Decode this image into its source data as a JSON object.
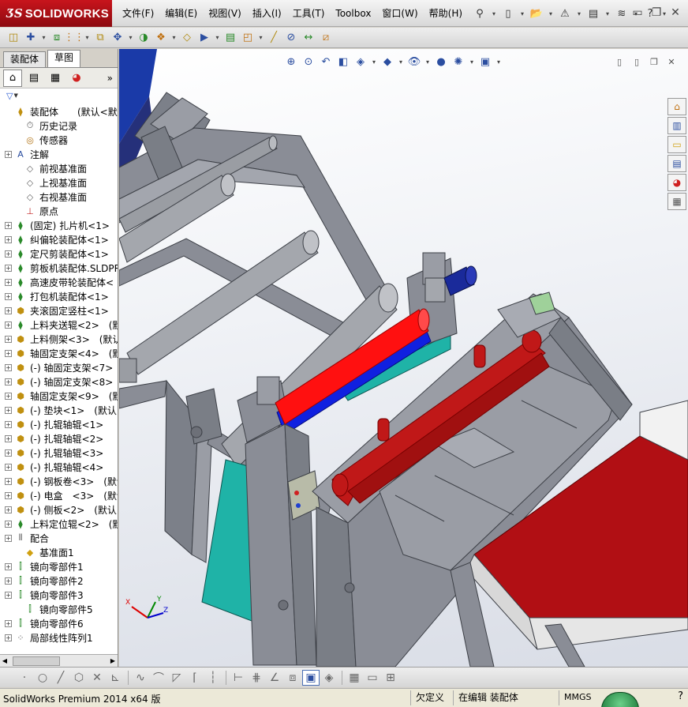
{
  "app": {
    "logo_mark": "ƷS",
    "logo_text": "SOLIDWORKS"
  },
  "menu": [
    "文件(F)",
    "编辑(E)",
    "视图(V)",
    "插入(I)",
    "工具(T)",
    "Toolbox",
    "窗口(W)",
    "帮助(H)"
  ],
  "title_tools": [
    {
      "icon": "pin-icon",
      "glyph": "⚲"
    },
    {
      "icon": "new-document-icon",
      "glyph": "▯"
    },
    {
      "icon": "open-folder-icon",
      "glyph": "📂"
    },
    {
      "icon": "rebuild-warning-icon",
      "glyph": "⚠"
    },
    {
      "icon": "print-icon",
      "glyph": "▤"
    },
    {
      "icon": "options-icon",
      "glyph": "≋"
    },
    {
      "icon": "help-icon",
      "glyph": "?"
    }
  ],
  "command_tools": [
    "edit-component-icon",
    "insert-component-icon",
    "mate-icon",
    "linear-pattern-icon",
    "smart-fasteners-icon",
    "move-component-icon",
    "show-hidden-icon",
    "assembly-features-icon",
    "reference-geometry-icon",
    "new-motion-study-icon",
    "bill-of-materials-icon",
    "exploded-view-icon",
    "explode-line-sketch-icon",
    "interference-detection-icon",
    "clearance-verification-icon",
    "instant3d-icon"
  ],
  "left_panel": {
    "tabs": [
      "装配体",
      "草图"
    ],
    "active_tab": 1,
    "filter_glyph": "▼",
    "more_glyph": "»",
    "tree": [
      {
        "label": "装配体　　(默认<默认_",
        "icon": "assembly",
        "expand": "none",
        "indent": 0
      },
      {
        "label": "历史记录",
        "icon": "history",
        "expand": "none",
        "indent": 1
      },
      {
        "label": "传感器",
        "icon": "sensor",
        "expand": "none",
        "indent": 1
      },
      {
        "label": "注解",
        "icon": "annotation",
        "expand": "plus",
        "indent": 0
      },
      {
        "label": "前视基准面",
        "icon": "plane",
        "expand": "none",
        "indent": 1
      },
      {
        "label": "上视基准面",
        "icon": "plane",
        "expand": "none",
        "indent": 1
      },
      {
        "label": "右视基准面",
        "icon": "plane",
        "expand": "none",
        "indent": 1
      },
      {
        "label": "原点",
        "icon": "origin",
        "expand": "none",
        "indent": 1
      },
      {
        "label": "(固定) 扎片机<1>",
        "icon": "subassembly",
        "expand": "plus",
        "indent": 0
      },
      {
        "label": "纠偏轮装配体<1>",
        "icon": "subassembly",
        "expand": "plus",
        "indent": 0
      },
      {
        "label": "定尺剪装配体<1>",
        "icon": "subassembly",
        "expand": "plus",
        "indent": 0
      },
      {
        "label": "剪板机装配体.SLDPR",
        "icon": "subassembly",
        "expand": "plus",
        "indent": 0
      },
      {
        "label": "高速皮带轮装配体<",
        "icon": "subassembly",
        "expand": "plus",
        "indent": 0
      },
      {
        "label": "打包机装配体<1>",
        "icon": "subassembly",
        "expand": "plus",
        "indent": 0
      },
      {
        "label": "夹滚固定竖柱<1>",
        "icon": "part",
        "expand": "plus",
        "indent": 0
      },
      {
        "label": "上料夹送辊<2>　(默认",
        "icon": "subassembly",
        "expand": "plus",
        "indent": 0
      },
      {
        "label": "上料侧架<3>　(默认",
        "icon": "part",
        "expand": "plus",
        "indent": 0
      },
      {
        "label": "轴固定支架<4>　(默认",
        "icon": "part",
        "expand": "plus",
        "indent": 0
      },
      {
        "label": "(-) 轴固定支架<7>",
        "icon": "part",
        "expand": "plus",
        "indent": 0
      },
      {
        "label": "(-) 轴固定支架<8>",
        "icon": "part",
        "expand": "plus",
        "indent": 0
      },
      {
        "label": "轴固定支架<9>　(默认",
        "icon": "part",
        "expand": "plus",
        "indent": 0
      },
      {
        "label": "(-) 垫块<1>　(默认",
        "icon": "part",
        "expand": "plus",
        "indent": 0
      },
      {
        "label": "(-) 扎辊轴辊<1>",
        "icon": "part",
        "expand": "plus",
        "indent": 0
      },
      {
        "label": "(-) 扎辊轴辊<2>",
        "icon": "part",
        "expand": "plus",
        "indent": 0
      },
      {
        "label": "(-) 扎辊轴辊<3>",
        "icon": "part",
        "expand": "plus",
        "indent": 0
      },
      {
        "label": "(-) 扎辊轴辊<4>",
        "icon": "part",
        "expand": "plus",
        "indent": 0
      },
      {
        "label": "(-) 钢板卷<3>　(默认",
        "icon": "part",
        "expand": "plus",
        "indent": 0
      },
      {
        "label": "(-) 电盒　<3>　(默认",
        "icon": "part",
        "expand": "plus",
        "indent": 0
      },
      {
        "label": "(-) 侧板<2>　(默认<",
        "icon": "part",
        "expand": "plus",
        "indent": 0
      },
      {
        "label": "上料定位辊<2>　(默认",
        "icon": "subassembly",
        "expand": "plus",
        "indent": 0
      },
      {
        "label": "配合",
        "icon": "mates",
        "expand": "plus",
        "indent": 0
      },
      {
        "label": "基准面1",
        "icon": "plane-yellow",
        "expand": "none",
        "indent": 1
      },
      {
        "label": "镜向零部件1",
        "icon": "mirror",
        "expand": "plus",
        "indent": 0
      },
      {
        "label": "镜向零部件2",
        "icon": "mirror",
        "expand": "plus",
        "indent": 0
      },
      {
        "label": "镜向零部件3",
        "icon": "mirror",
        "expand": "plus",
        "indent": 0
      },
      {
        "label": "镜向零部件5",
        "icon": "mirror",
        "expand": "none",
        "indent": 1
      },
      {
        "label": "镜向零部件6",
        "icon": "mirror",
        "expand": "plus",
        "indent": 0
      },
      {
        "label": "局部线性阵列1",
        "icon": "pattern",
        "expand": "plus",
        "indent": 0
      }
    ]
  },
  "heads_up_toolbar": [
    {
      "icon": "zoom-to-fit-icon",
      "glyph": "⊕"
    },
    {
      "icon": "zoom-to-area-icon",
      "glyph": "⊙"
    },
    {
      "icon": "previous-view-icon",
      "glyph": "↶"
    },
    {
      "icon": "section-view-icon",
      "glyph": "◧"
    },
    {
      "icon": "view-orientation-icon",
      "glyph": "◈"
    },
    {
      "icon": "display-style-icon",
      "glyph": "◆"
    },
    {
      "icon": "hide-show-items-icon",
      "glyph": "👁"
    },
    {
      "icon": "edit-appearance-icon",
      "glyph": "●"
    },
    {
      "icon": "apply-scene-icon",
      "glyph": "✺"
    },
    {
      "icon": "view-settings-icon",
      "glyph": "▣"
    }
  ],
  "task_pane": [
    "home-icon",
    "design-library-icon",
    "file-explorer-icon",
    "view-palette-icon",
    "appearances-icon",
    "custom-properties-icon"
  ],
  "triad": {
    "x": "X",
    "y": "Y",
    "z": "Z"
  },
  "bottom_toolbar": [
    "point-icon",
    "circle-icon",
    "line-icon",
    "polygon-icon",
    "trim-icon",
    "extend-icon",
    "spline-icon",
    "sketch-fillet-icon",
    "convert-entities-icon",
    "corner-rectangle-icon",
    "centerline-icon",
    "dimension-icon",
    "grid-icon",
    "angle-icon",
    "3d-box-icon",
    "shaded-cube-icon",
    "display-cube-icon",
    "section-icon",
    "panel-view-icon",
    "tile-view-icon"
  ],
  "status": {
    "product": "SolidWorks Premium 2014 x64 版",
    "under_defined": "欠定义",
    "editing": "在编辑 装配体",
    "units": "MMGS",
    "help_glyph": "?"
  },
  "colors": {
    "logo_red": "#b0121a",
    "machine_gray": "#8a8d96",
    "roller_red": "#ff1010",
    "roller_blue": "#1020e0",
    "teal_panel": "#1fb3a7",
    "conveyor_red": "#b10f14"
  }
}
